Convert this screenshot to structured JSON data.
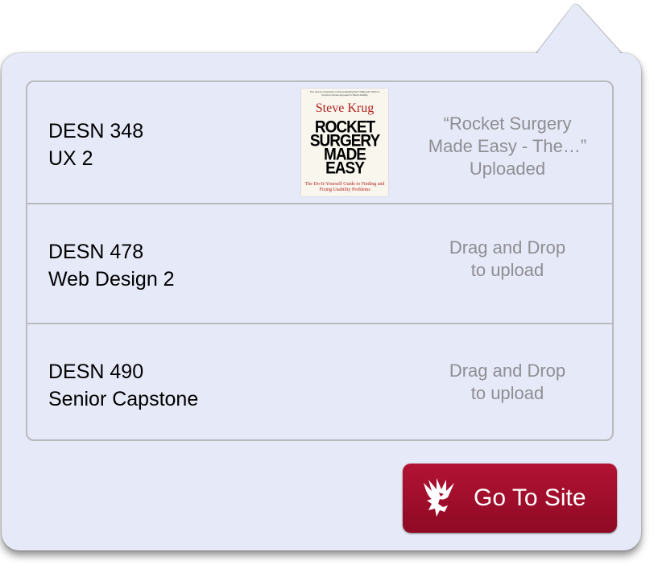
{
  "courses": [
    {
      "code": "DESN 348",
      "name": "UX 2",
      "status_lines": [
        "“Rocket Surgery",
        "Made Easy - The…”",
        "Uploaded"
      ]
    },
    {
      "code": "DESN 478",
      "name": "Web Design 2",
      "status_lines": [
        "Drag and Drop",
        "to upload"
      ]
    },
    {
      "code": "DESN 490",
      "name": "Senior Capstone",
      "status_lines": [
        "Drag and Drop",
        "to upload"
      ]
    }
  ],
  "book": {
    "top_blurb": "The how-to companion to the bestselling Don't Make Me Think! A Common Sense Approach to Web Usability",
    "author": "Steve Krug",
    "title_lines": [
      "ROCKET",
      "SURGERY",
      "MADE",
      "EASY"
    ],
    "subtitle": "The Do-It-Yourself Guide to Finding and Fixing Usability Problems"
  },
  "button": {
    "label": "Go To Site",
    "icon": "eagle-logo-icon"
  },
  "colors": {
    "panel": "#e6e9f7",
    "button": "#a0102c",
    "status_text": "#8e8e93",
    "book_red": "#b3221e"
  }
}
